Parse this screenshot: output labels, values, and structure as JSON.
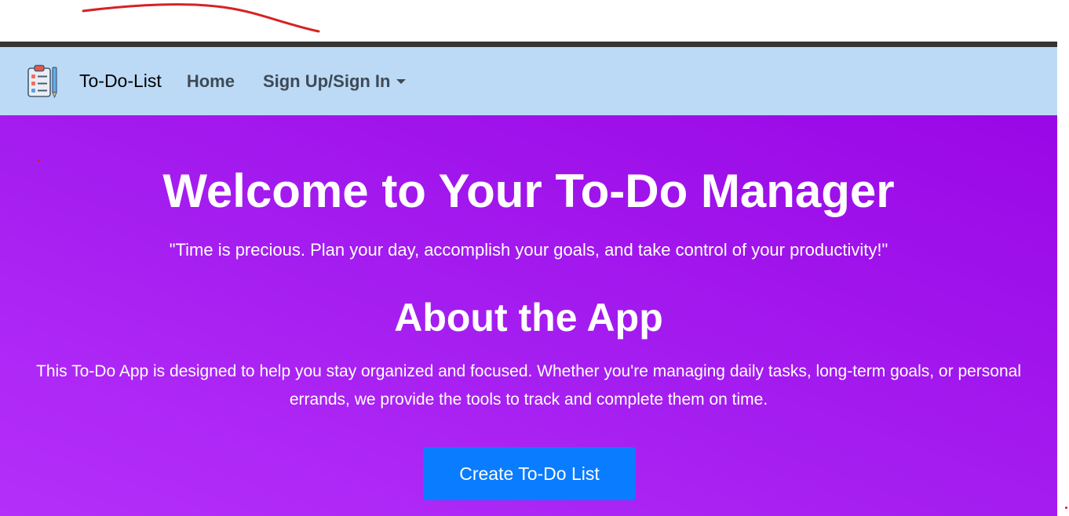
{
  "navbar": {
    "brand_name": "To-Do-List",
    "logo_icon": "clipboard-checklist-pencil-icon",
    "links": [
      {
        "label": "Home"
      },
      {
        "label": "Sign Up/Sign In",
        "has_dropdown": true
      }
    ]
  },
  "hero": {
    "title": "Welcome to Your To-Do Manager",
    "quote": "\"Time is precious. Plan your day, accomplish your goals, and take control of your productivity!\"",
    "about_title": "About the App",
    "about_text": "This To-Do App is designed to help you stay organized and focused. Whether you're managing daily tasks, long-term goals, or personal errands, we provide the tools to track and complete them on time.",
    "cta_label": "Create To-Do List"
  },
  "colors": {
    "navbar_bg": "#bcdaf5",
    "hero_gradient_start": "#b52ffa",
    "hero_gradient_end": "#9a07e6",
    "cta_bg": "#0a7cff",
    "annotation": "#d62222"
  }
}
